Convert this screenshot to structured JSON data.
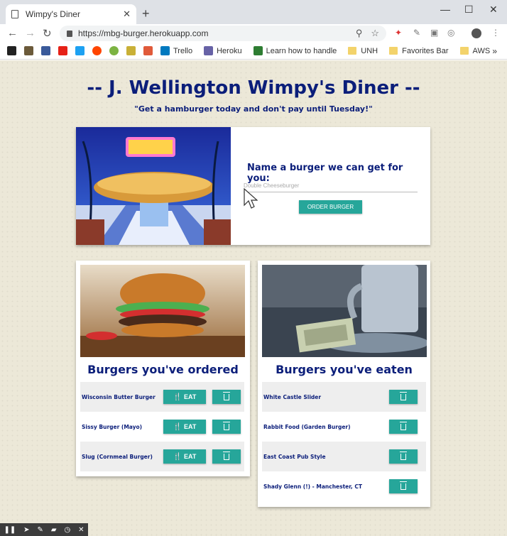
{
  "browser": {
    "tab_title": "Wimpy's Diner",
    "url": "https://mbg-burger.herokuapp.com",
    "bookmarks": [
      {
        "label": "Trello",
        "color": "#0079bf"
      },
      {
        "label": "Heroku",
        "color": "#6762a6"
      },
      {
        "label": "Learn how to handle",
        "color": "#2e7d32"
      }
    ],
    "folders": [
      "UNH",
      "Favorites Bar",
      "AWS"
    ]
  },
  "header": {
    "title": "-- J. Wellington Wimpy's Diner --",
    "tagline": "\"Get a hamburger today and don't pay until Tuesday!\""
  },
  "order_form": {
    "label": "Name a burger we can get for you:",
    "placeholder": "Double Cheeseburger",
    "button_label": "ORDER BURGER"
  },
  "ordered": {
    "title": "Burgers you've ordered",
    "eat_label": "EAT",
    "items": [
      "Wisconsin Butter Burger",
      "Sissy Burger (Mayo)",
      "Slug (Cornmeal Burger)"
    ]
  },
  "eaten": {
    "title": "Burgers you've eaten",
    "items": [
      "White Castle Slider",
      "Rabbit Food (Garden Burger)",
      "East Coast Pub Style",
      "Shady Glenn (!) - Manchester, CT"
    ]
  },
  "colors": {
    "accent": "#26a69a",
    "title": "#0b1e7a",
    "page_bg": "#ece8d8"
  }
}
